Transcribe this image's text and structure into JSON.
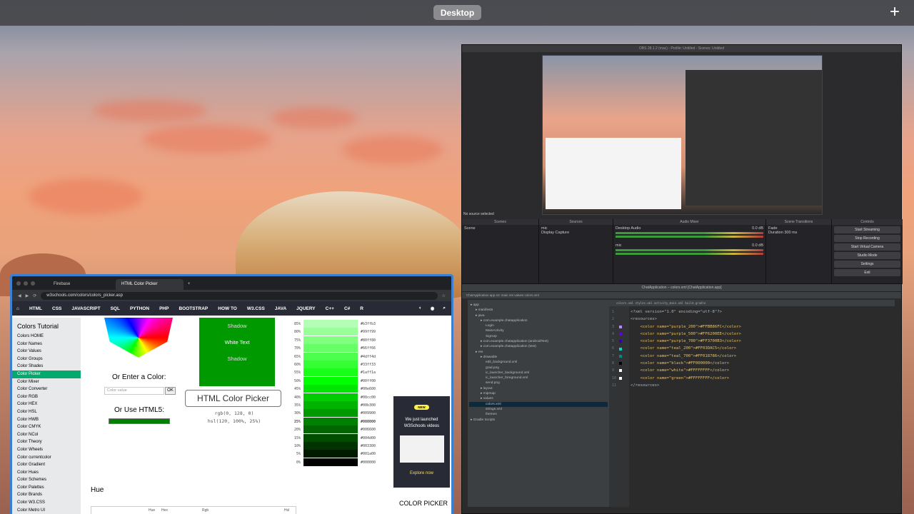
{
  "topbar": {
    "desktop_label": "Desktop",
    "add_label": "+"
  },
  "obs": {
    "title": "OBS 28.1.2 (mac) - Profile: Untitled - Scenes: Untitled",
    "no_source": "No source selected",
    "panels": {
      "scenes": "Scenes",
      "sources": "Sources",
      "mixer": "Audio Mixer",
      "transitions": "Scene Transitions",
      "controls": "Controls"
    },
    "scenes": [
      "Scene"
    ],
    "sources": [
      "mic",
      "Display Capture"
    ],
    "mixer": [
      {
        "name": "Desktop Audio",
        "level": "0.0 dB"
      },
      {
        "name": "mic",
        "level": "0.0 dB"
      }
    ],
    "transition": {
      "type": "Fade",
      "duration_label": "Duration",
      "duration": "300 ms"
    },
    "controls": [
      "Start Streaming",
      "Stop Recording",
      "Start Virtual Camera",
      "Studio Mode",
      "Settings",
      "Exit"
    ]
  },
  "studio": {
    "title": "ChatApplication – colors.xml [ChatApplication.app]",
    "toolbar": "ChatApplication  app  src  main  res  values  colors.xml",
    "tabs": "colors.xml   styles.xml   activity_main.xml   build.gradle",
    "tree": [
      {
        "label": "app",
        "indent": 0
      },
      {
        "label": "manifests",
        "indent": 1
      },
      {
        "label": "java",
        "indent": 1
      },
      {
        "label": "com.example.chatapplication",
        "indent": 2
      },
      {
        "label": "Login",
        "indent": 3
      },
      {
        "label": "MainActivity",
        "indent": 3
      },
      {
        "label": "SignUp",
        "indent": 3
      },
      {
        "label": "com.example.chatapplication (androidTest)",
        "indent": 2
      },
      {
        "label": "com.example.chatapplication (test)",
        "indent": 2
      },
      {
        "label": "res",
        "indent": 1
      },
      {
        "label": "drawable",
        "indent": 2
      },
      {
        "label": "edit_background.xml",
        "indent": 3
      },
      {
        "label": "grad.png",
        "indent": 3
      },
      {
        "label": "ic_launcher_background.xml",
        "indent": 3
      },
      {
        "label": "ic_launcher_foreground.xml",
        "indent": 3
      },
      {
        "label": "send.png",
        "indent": 3
      },
      {
        "label": "layout",
        "indent": 2
      },
      {
        "label": "mipmap",
        "indent": 2
      },
      {
        "label": "values",
        "indent": 2
      },
      {
        "label": "colors.xml",
        "indent": 3,
        "selected": true
      },
      {
        "label": "strings.xml",
        "indent": 3
      },
      {
        "label": "themes",
        "indent": 3
      },
      {
        "label": "Gradle Scripts",
        "indent": 0
      }
    ],
    "code": [
      {
        "ln": "1",
        "text": "<?xml version=\"1.0\" encoding=\"utf-8\"?>"
      },
      {
        "ln": "2",
        "text": "<resources>"
      },
      {
        "ln": "3",
        "text": "    <color name=\"purple_200\">#FFBB86FC</color>",
        "swatch": "#bb86fc"
      },
      {
        "ln": "4",
        "text": "    <color name=\"purple_500\">#FF6200EE</color>",
        "swatch": "#6200ee"
      },
      {
        "ln": "5",
        "text": "    <color name=\"purple_700\">#FF3700B3</color>",
        "swatch": "#3700b3"
      },
      {
        "ln": "6",
        "text": "    <color name=\"teal_200\">#FF03DAC5</color>",
        "swatch": "#03dac5"
      },
      {
        "ln": "7",
        "text": "    <color name=\"teal_700\">#FF018786</color>",
        "swatch": "#018786"
      },
      {
        "ln": "8",
        "text": "    <color name=\"black\">#FF000000</color>",
        "swatch": "#000000"
      },
      {
        "ln": "9",
        "text": "    <color name=\"white\">#FFFFFFFF</color>",
        "swatch": "#ffffff"
      },
      {
        "ln": "10",
        "text": "    <color name=\"green\">#FFFFFFFF</color>",
        "swatch": "#ffffff"
      },
      {
        "ln": "11",
        "text": "</resources>"
      }
    ]
  },
  "browser": {
    "tabs": [
      "Firebase",
      "HTML Color Picker"
    ],
    "new_tab": "+",
    "url": "w3schools.com/colors/colors_picker.asp",
    "nav": [
      "HTML",
      "CSS",
      "JAVASCRIPT",
      "SQL",
      "PYTHON",
      "PHP",
      "BOOTSTRAP",
      "HOW TO",
      "W3.CSS",
      "JAVA",
      "JQUERY",
      "C++",
      "C#",
      "R"
    ],
    "sidebar_title": "Colors Tutorial",
    "sidebar": [
      "Colors HOME",
      "Color Names",
      "Color Values",
      "Color Groups",
      "Color Shades",
      "Color Picker",
      "Color Mixer",
      "Color Converter",
      "Color RGB",
      "Color HEX",
      "Color HSL",
      "Color HWB",
      "Color CMYK",
      "Color NCol",
      "Color Theory",
      "Color Wheels",
      "Color currentcolor",
      "Color Gradient",
      "Color Hues",
      "Color Schemes",
      "Color Palettes",
      "Color Brands",
      "Color W3.CSS",
      "Color Metro UI"
    ],
    "sidebar_selected": 5,
    "preview": [
      "Shadow",
      "White Text",
      "Shadow"
    ],
    "enter_color": "Or Enter a Color:",
    "color_placeholder": "Color value",
    "ok": "OK",
    "use_html5": "Or Use HTML5:",
    "picker_button": "HTML Color Picker",
    "rgb": "rgb(0, 128, 0)",
    "hsl": "hsl(120, 100%, 25%)",
    "shades": [
      {
        "pct": "85%",
        "hex": "#b3ffb3",
        "color": "#b3ffb3"
      },
      {
        "pct": "80%",
        "hex": "#99ff99",
        "color": "#99ff99"
      },
      {
        "pct": "75%",
        "hex": "#80ff80",
        "color": "#80ff80"
      },
      {
        "pct": "70%",
        "hex": "#66ff66",
        "color": "#66ff66"
      },
      {
        "pct": "65%",
        "hex": "#4dff4d",
        "color": "#4dff4d"
      },
      {
        "pct": "60%",
        "hex": "#33ff33",
        "color": "#33ff33"
      },
      {
        "pct": "55%",
        "hex": "#1aff1a",
        "color": "#1aff1a"
      },
      {
        "pct": "50%",
        "hex": "#00ff00",
        "color": "#00ff00"
      },
      {
        "pct": "45%",
        "hex": "#00e600",
        "color": "#00e600"
      },
      {
        "pct": "40%",
        "hex": "#00cc00",
        "color": "#00cc00"
      },
      {
        "pct": "35%",
        "hex": "#00b300",
        "color": "#00b300"
      },
      {
        "pct": "30%",
        "hex": "#009900",
        "color": "#009900"
      },
      {
        "pct": "25%",
        "hex": "#008000",
        "color": "#008000"
      },
      {
        "pct": "20%",
        "hex": "#006600",
        "color": "#006600"
      },
      {
        "pct": "15%",
        "hex": "#004d00",
        "color": "#004d00"
      },
      {
        "pct": "10%",
        "hex": "#003300",
        "color": "#003300"
      },
      {
        "pct": "5%",
        "hex": "#001a00",
        "color": "#001a00"
      },
      {
        "pct": "0%",
        "hex": "#000000",
        "color": "#000000"
      }
    ],
    "ad": {
      "badge": "NEW",
      "line1": "We just launched",
      "line2": "W3Schools videos",
      "cta": "Explore now"
    },
    "color_picker_label": "COLOR PICKER",
    "hue_heading": "Hue",
    "hue_cols": [
      "Hue",
      "Hex",
      "Rgb",
      "Hsl"
    ]
  }
}
